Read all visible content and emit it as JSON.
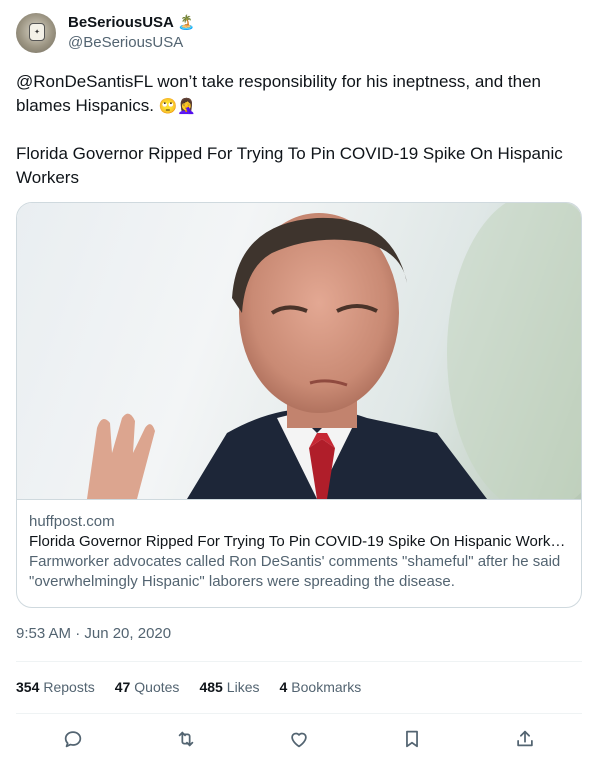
{
  "author": {
    "display_name": "BeSeriousUSA",
    "handle": "@BeSeriousUSA",
    "name_emoji": "🏝️",
    "avatar_icon": "avatar-icon"
  },
  "tweet": {
    "line1": "@RonDeSantisFL won’t take responsibility for his ineptness, and then blames Hispanics.",
    "line1_emoji": "🙄🤦‍♀️",
    "line2": "Florida Governor Ripped For Trying To Pin COVID-19 Spike On Hispanic Workers"
  },
  "card": {
    "domain": "huffpost.com",
    "title": "Florida Governor Ripped For Trying To Pin COVID-19 Spike On Hispanic Workers",
    "description": "Farmworker advocates called Ron DeSantis' comments \"shameful\" after he said \"overwhelmingly Hispanic\" laborers were spreading the disease."
  },
  "timestamp": "9:53 AM · Jun 20, 2020",
  "stats": [
    {
      "count": "354",
      "label": "Reposts"
    },
    {
      "count": "47",
      "label": "Quotes"
    },
    {
      "count": "485",
      "label": "Likes"
    },
    {
      "count": "4",
      "label": "Bookmarks"
    }
  ],
  "actions": [
    {
      "name": "reply-icon"
    },
    {
      "name": "repost-icon"
    },
    {
      "name": "like-icon"
    },
    {
      "name": "bookmark-icon"
    },
    {
      "name": "share-icon"
    }
  ],
  "colors": {
    "text": "#0f1419",
    "secondary": "#536471",
    "border": "#cfd9de"
  }
}
